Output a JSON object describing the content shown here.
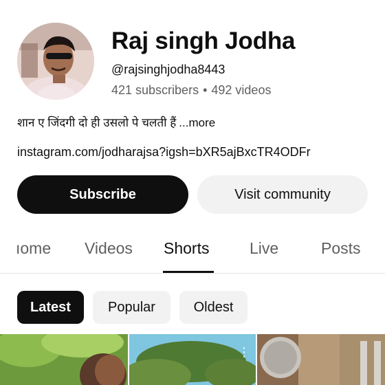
{
  "channel": {
    "name": "Raj singh Jodha",
    "handle": "@rajsinghjodha8443",
    "subscribers": "421 subscribers",
    "separator": "•",
    "videos": "492 videos",
    "description": "शान ए जिंदगी दो ही उसलो पे  चलती हैं",
    "more_label": "...more",
    "link": "instagram.com/jodharajsa?igsh=bXR5ajBxcTR4ODFr"
  },
  "actions": {
    "subscribe_label": "Subscribe",
    "community_label": "Visit community"
  },
  "tabs": [
    {
      "label": "Home",
      "visible_text": "ıome",
      "active": false
    },
    {
      "label": "Videos",
      "active": false
    },
    {
      "label": "Shorts",
      "active": true
    },
    {
      "label": "Live",
      "active": false
    },
    {
      "label": "Posts",
      "active": false
    }
  ],
  "filters": [
    {
      "label": "Latest",
      "selected": true
    },
    {
      "label": "Popular",
      "selected": false
    },
    {
      "label": "Oldest",
      "selected": false
    }
  ],
  "thumbnails": [
    {
      "icon": "short-thumbnail"
    },
    {
      "icon": "short-thumbnail"
    },
    {
      "icon": "short-thumbnail"
    }
  ],
  "colors": {
    "primary": "#0f0f0f",
    "secondary_text": "#606060",
    "chip_bg": "#f2f2f2"
  }
}
